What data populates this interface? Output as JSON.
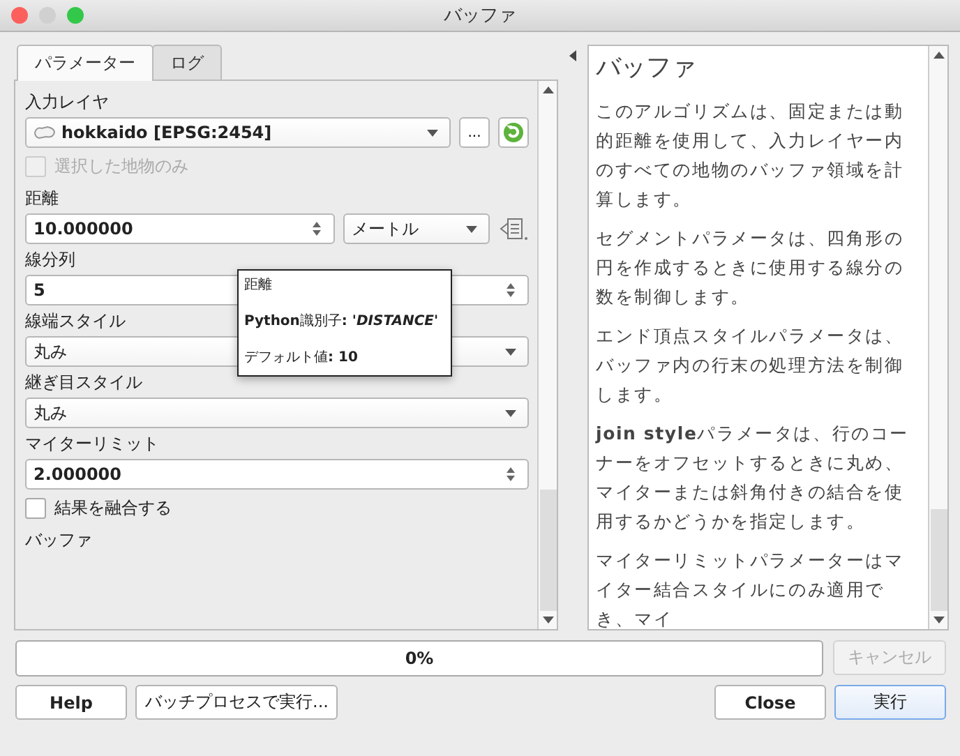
{
  "window": {
    "title": "バッファ"
  },
  "tabs": [
    {
      "label": "パラメーター",
      "selected": true
    },
    {
      "label": "ログ",
      "selected": false
    }
  ],
  "params": [
    {
      "kind": "layer",
      "label": "入力レイヤ",
      "value": "hokkaido [EPSG:2454]",
      "button": "..."
    },
    {
      "kind": "checkbox",
      "label": "選択した地物のみ",
      "checked": false,
      "disabled": true
    },
    {
      "kind": "distance",
      "label": "距離",
      "value": "10.000000",
      "unit": "メートル"
    },
    {
      "kind": "spin",
      "label": "線分列",
      "value": "5"
    },
    {
      "kind": "select",
      "label": "線端スタイル",
      "value": "丸み"
    },
    {
      "kind": "select",
      "label": "継ぎ目スタイル",
      "value": "丸み"
    },
    {
      "kind": "spin",
      "label": "マイターリミット",
      "value": "2.000000"
    },
    {
      "kind": "checkbox",
      "label": "結果を融合する",
      "checked": false,
      "disabled": false
    },
    {
      "kind": "heading",
      "label": "バッファ"
    }
  ],
  "tooltip": {
    "title": "距離",
    "lines": [
      "**Python**識別子**: '*DISTANCE*'**",
      "デフォルト値**: 10**"
    ]
  },
  "help": {
    "title": "バッファ",
    "paragraphs": [
      "このアルゴリズムは、固定または動的距離を使用して、入力レイヤー内のすべての地物のバッファ領域を計算します。",
      "セグメントパラメータは、四角形の円を作成するときに使用する線分の数を制御します。",
      "エンド頂点スタイルパラメータは、バッファ内の行末の処理方法を制御します。",
      "**join style**パラメータは、行のコーナーをオフセットするときに丸め、マイターまたは斜角付きの結合を使用するかどうかを指定します。",
      "マイターリミットパラメーターはマイター結合スタイルにのみ適用でき、マイ"
    ]
  },
  "progress": {
    "level": 0,
    "text": "0%"
  },
  "cancel": {
    "label": "キャンセル",
    "disabled": true
  },
  "buttons": [
    {
      "label": "Help",
      "kind": "plain"
    },
    {
      "label": "バッチプロセスで実行...",
      "kind": "plain"
    },
    {
      "label": "Close",
      "kind": "plain"
    },
    {
      "label": "実行",
      "kind": "default"
    }
  ]
}
